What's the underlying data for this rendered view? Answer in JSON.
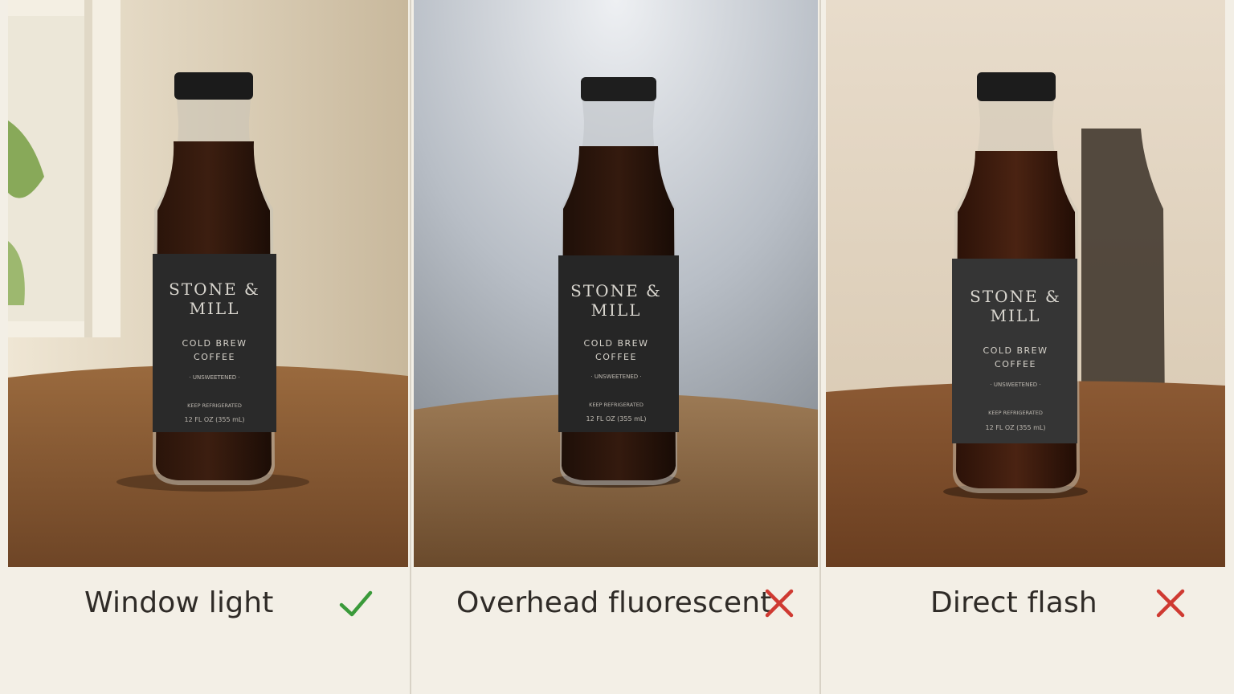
{
  "panels": [
    {
      "caption": "Window light",
      "verdict": "good",
      "mark_color": "#3a9a3a",
      "label": {
        "brand_line1": "STONE &",
        "brand_line2": "MILL",
        "product_line1": "COLD BREW",
        "product_line2": "COFFEE",
        "variant": "· UNSWEETENED ·",
        "storage": "KEEP REFRIGERATED",
        "volume": "12 FL OZ (355 mL)"
      }
    },
    {
      "caption": "Overhead fluorescent",
      "verdict": "bad",
      "mark_color": "#cf3a32",
      "label": {
        "brand_line1": "STONE &",
        "brand_line2": "MILL",
        "product_line1": "COLD BREW",
        "product_line2": "COFFEE",
        "variant": "· UNSWEETENED ·",
        "storage": "KEEP REFRIGERATED",
        "volume": "12 FL OZ (355 mL)"
      }
    },
    {
      "caption": "Direct flash",
      "verdict": "bad",
      "mark_color": "#cf3a32",
      "label": {
        "brand_line1": "STONE &",
        "brand_line2": "MILL",
        "product_line1": "COLD BREW",
        "product_line2": "COFFEE",
        "variant": "· UNSWEETENED ·",
        "storage": "KEEP REFRIGERATED",
        "volume": "12 FL OZ (355 mL)"
      }
    }
  ],
  "icons": {
    "good": "checkmark-icon",
    "bad": "cross-icon"
  }
}
